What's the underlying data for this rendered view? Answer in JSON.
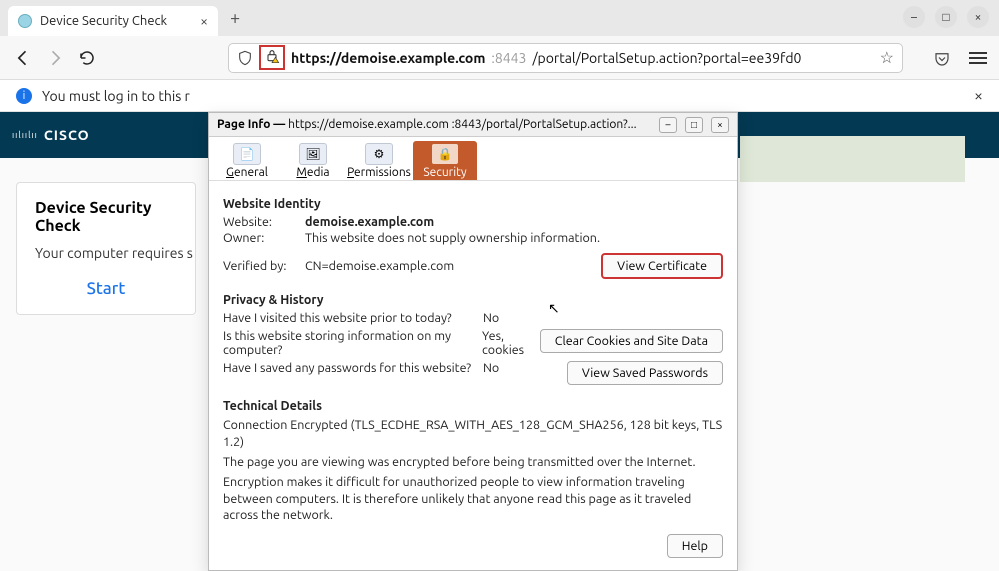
{
  "tab": {
    "title": "Device Security Check"
  },
  "addrbar": {
    "host": "https://demoise.example.com",
    "port": ":8443",
    "path": "/portal/PortalSetup.action?portal=ee39fd0"
  },
  "infobar": {
    "text": "You must log in to this r"
  },
  "brand": "CISCO",
  "card": {
    "title": "Device Security Check",
    "subtitle": "Your computer requires s",
    "start": "Start"
  },
  "dialog": {
    "title_prefix": "Page Info — ",
    "title_url": "https://demoise.example.com :8443/portal/PortalSetup.action?...",
    "tabs": {
      "general": "General",
      "media": "Media",
      "permissions": "Permissions",
      "security": "Security"
    },
    "identity": {
      "heading": "Website Identity",
      "website_label": "Website:",
      "website": "demoise.example.com",
      "owner_label": "Owner:",
      "owner": "This website does not supply ownership information.",
      "verified_label": "Verified by:",
      "verified": "CN=demoise.example.com",
      "view_cert": "View Certificate"
    },
    "privacy": {
      "heading": "Privacy & History",
      "q_visited": "Have I visited this website prior to today?",
      "a_visited": "No",
      "q_storing": "Is this website storing information on my computer?",
      "a_storing": "Yes, cookies",
      "btn_clear": "Clear Cookies and Site Data",
      "q_passwords": "Have I saved any passwords for this website?",
      "a_passwords": "No",
      "btn_passwords": "View Saved Passwords"
    },
    "technical": {
      "heading": "Technical Details",
      "line1": "Connection Encrypted (TLS_ECDHE_RSA_WITH_AES_128_GCM_SHA256, 128 bit keys, TLS 1.2)",
      "line2": "The page you are viewing was encrypted before being transmitted over the Internet.",
      "line3": "Encryption makes it difficult for unauthorized people to view information traveling between computers. It is therefore unlikely that anyone read this page as it traveled across the network."
    },
    "help": "Help"
  }
}
